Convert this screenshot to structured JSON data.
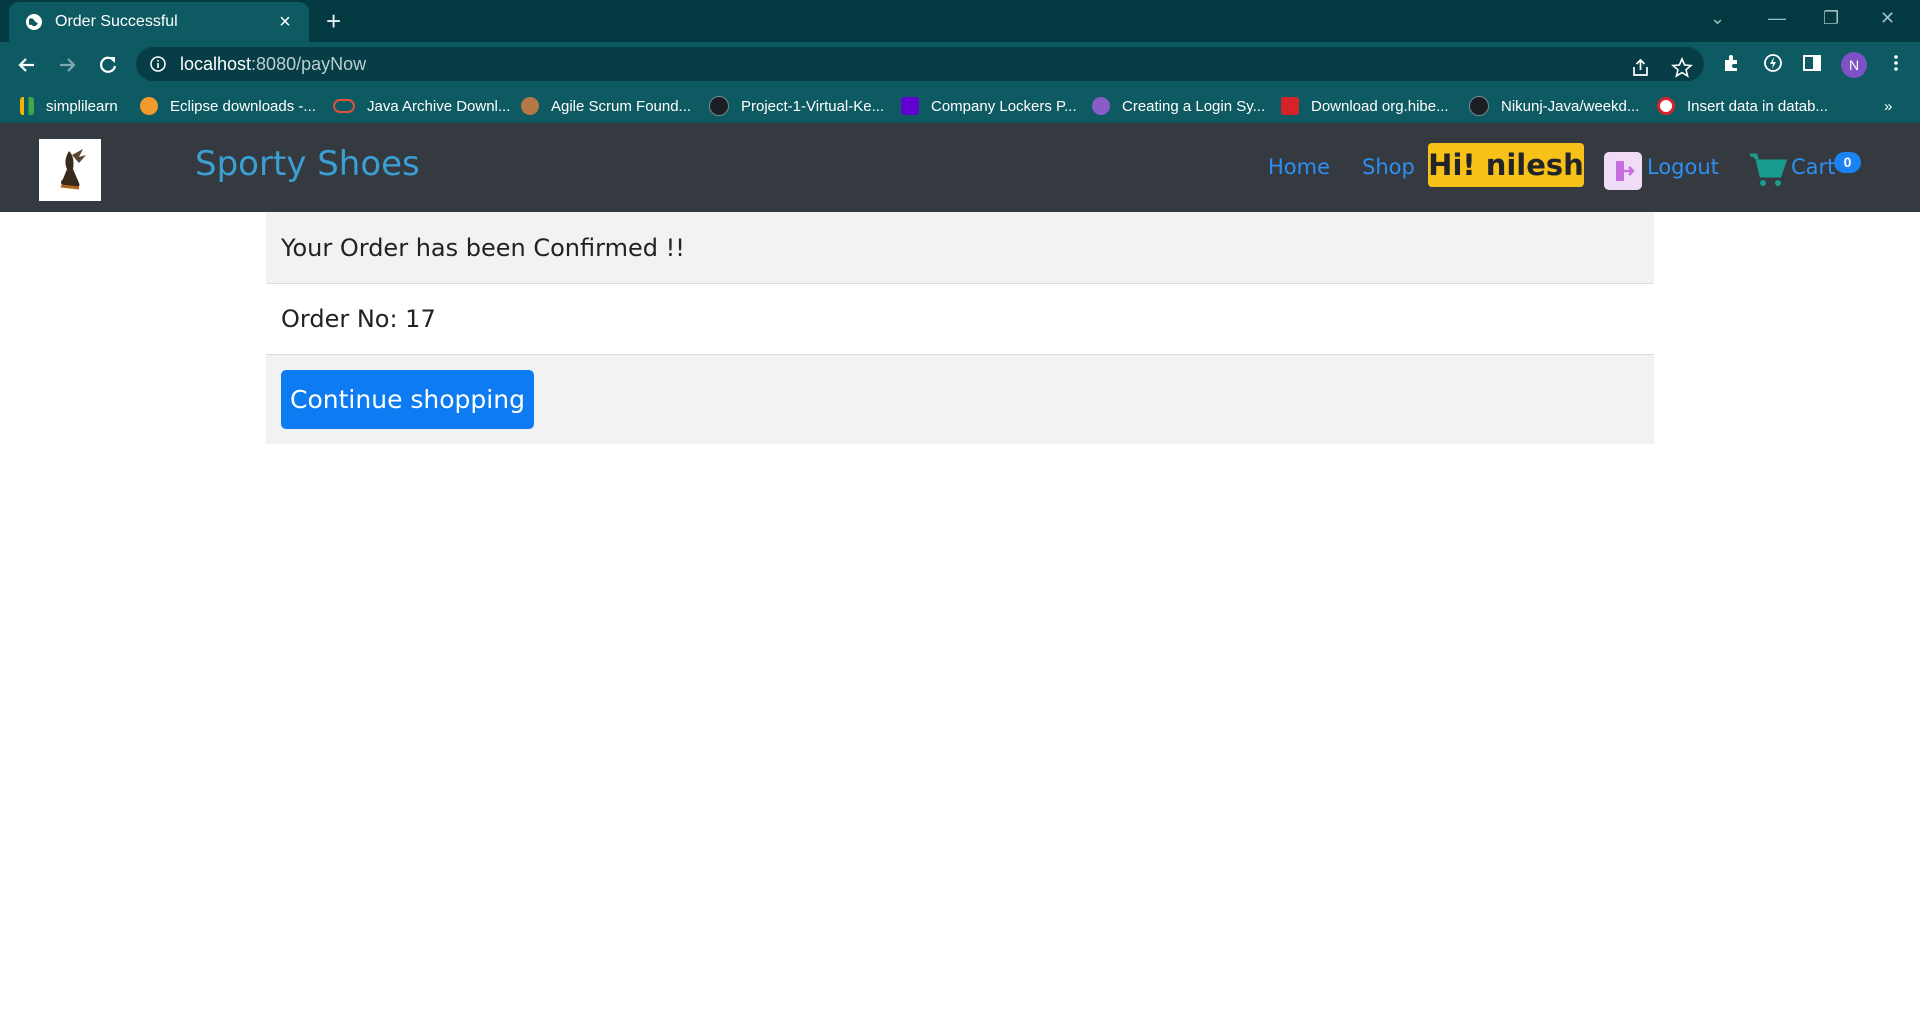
{
  "browser": {
    "tab_title": "Order Successful",
    "new_tab_symbol": "+",
    "url_host": "localhost",
    "url_path": ":8080/payNow",
    "profile_initial": "N",
    "bookmarks": [
      {
        "label": "simplilearn",
        "icon": "simplilearn-icon",
        "color": "#f5b400"
      },
      {
        "label": "Eclipse downloads -...",
        "icon": "eclipse-icon",
        "color": "#f29a2e"
      },
      {
        "label": "Java Archive Downl...",
        "icon": "oracle-icon",
        "color": "#e0533a"
      },
      {
        "label": "Agile Scrum Found...",
        "icon": "agile-icon",
        "color": "#b47a45"
      },
      {
        "label": "Project-1-Virtual-Ke...",
        "icon": "github-icon",
        "color": "#1b1f24"
      },
      {
        "label": "Company Lockers P...",
        "icon": "yahoo-icon",
        "color": "#6001d2"
      },
      {
        "label": "Creating a Login Sy...",
        "icon": "st-icon",
        "color": "#8a5cc8"
      },
      {
        "label": "Download org.hibe...",
        "icon": "download-icon",
        "color": "#d6232a"
      },
      {
        "label": "Nikunj-Java/weekd...",
        "icon": "github-icon",
        "color": "#1b1f24"
      },
      {
        "label": "Insert data in datab...",
        "icon": "database-icon",
        "color": "#d6232a"
      }
    ],
    "more_bookmarks": "»"
  },
  "site": {
    "brand": "Sporty Shoes",
    "nav": {
      "home": "Home",
      "shop": "Shop",
      "greeting": "Hi! nilesh",
      "logout": "Logout",
      "cart": "Cart",
      "cart_count": "0"
    },
    "colors": {
      "navbar": "#343a40",
      "brand": "#3b9fd4",
      "link": "#2f8ff0",
      "greeting_bg": "#f8c118",
      "primary": "#0d7cf2"
    }
  },
  "order": {
    "confirmation": "Your Order has been Confirmed !!",
    "order_number": "Order No: 17",
    "continue_label": "Continue shopping"
  }
}
